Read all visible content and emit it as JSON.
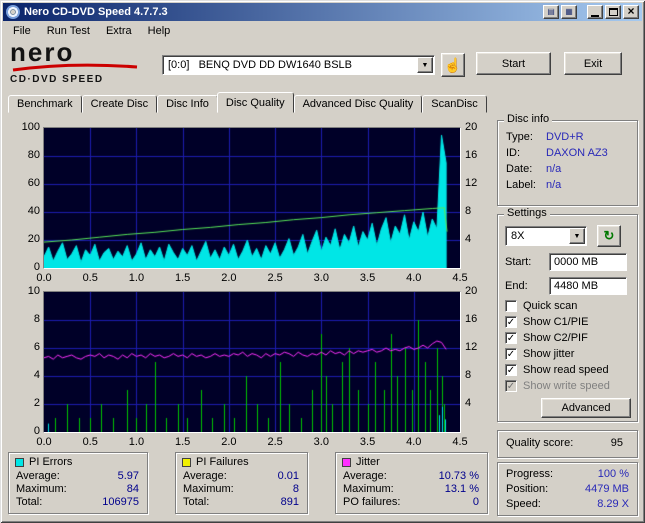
{
  "window": {
    "title": "Nero CD-DVD Speed 4.7.7.3",
    "menu_items": [
      "File",
      "Run Test",
      "Extra",
      "Help"
    ]
  },
  "icons": {
    "app": "cd-disc",
    "close": "×",
    "minimize": "minimize-bar",
    "maximize": "window-box",
    "dropdown": "▼",
    "check": "✓",
    "refresh": "↻",
    "hand": "☝",
    "extra1": "▤",
    "extra2": "▦"
  },
  "logo": {
    "brand": "nero",
    "product": "CD·DVD SPEED"
  },
  "toolbar": {
    "drive_selector": "[0:0]   BENQ DVD DD DW1640 BSLB",
    "start_button": "Start",
    "exit_button": "Exit"
  },
  "tabs": {
    "items": [
      {
        "label": "Benchmark",
        "active": false
      },
      {
        "label": "Create Disc",
        "active": false
      },
      {
        "label": "Disc Info",
        "active": false
      },
      {
        "label": "Disc Quality",
        "active": true
      },
      {
        "label": "Advanced Disc Quality",
        "active": false
      },
      {
        "label": "ScanDisc",
        "active": false
      }
    ]
  },
  "disc_info": {
    "title": "Disc info",
    "rows": [
      {
        "label": "Type:",
        "value": "DVD+R"
      },
      {
        "label": "ID:",
        "value": "DAXON AZ3"
      },
      {
        "label": "Date:",
        "value": "n/a"
      },
      {
        "label": "Label:",
        "value": "n/a"
      }
    ]
  },
  "settings": {
    "title": "Settings",
    "speed_value": "8X",
    "start_label": "Start:",
    "start_value": "0000 MB",
    "end_label": "End:",
    "end_value": "4480 MB",
    "checkboxes": [
      {
        "label": "Quick scan",
        "checked": false,
        "disabled": false
      },
      {
        "label": "Show C1/PIE",
        "checked": true,
        "disabled": false
      },
      {
        "label": "Show C2/PIF",
        "checked": true,
        "disabled": false
      },
      {
        "label": "Show jitter",
        "checked": true,
        "disabled": false
      },
      {
        "label": "Show read speed",
        "checked": true,
        "disabled": false
      },
      {
        "label": "Show write speed",
        "checked": true,
        "disabled": true
      }
    ],
    "advanced_button": "Advanced"
  },
  "quality": {
    "label": "Quality score:",
    "value": "95"
  },
  "progress": {
    "rows": [
      {
        "label": "Progress:",
        "value": "100 %"
      },
      {
        "label": "Position:",
        "value": "4479 MB"
      },
      {
        "label": "Speed:",
        "value": "8.29 X"
      }
    ]
  },
  "stats": {
    "pi_errors": {
      "title": "PI Errors",
      "color": "#00e6e6",
      "rows": [
        [
          "Average:",
          "5.97"
        ],
        [
          "Maximum:",
          "84"
        ],
        [
          "Total:",
          "106975"
        ]
      ]
    },
    "pi_failures": {
      "title": "PI Failures",
      "color": "#f0f000",
      "rows": [
        [
          "Average:",
          "0.01"
        ],
        [
          "Maximum:",
          "8"
        ],
        [
          "Total:",
          "891"
        ]
      ]
    },
    "jitter": {
      "title": "Jitter",
      "color": "#ff30ff",
      "rows": [
        [
          "Average:",
          "10.73 %"
        ],
        [
          "Maximum:",
          "13.1 %"
        ],
        [
          "PO failures:",
          "0"
        ]
      ]
    }
  },
  "colors": {
    "window_bg": "#d4d0c8",
    "titlebar_start": "#0a246a",
    "titlebar_end": "#a6caf0",
    "info_value": "#2929b8",
    "stat_value": "#00008c"
  },
  "chart_data": [
    {
      "type": "area",
      "x_axis": {
        "min": 0,
        "max": 4.5,
        "step": 0.5,
        "ticks": [
          "0.0",
          "0.5",
          "1.0",
          "1.5",
          "2.0",
          "2.5",
          "3.0",
          "3.5",
          "4.0",
          "4.5"
        ]
      },
      "left_axis": {
        "min": 0,
        "max": 100,
        "step": 20,
        "ticks": [
          100,
          80,
          60,
          40,
          20,
          0
        ]
      },
      "right_axis": {
        "min": 0,
        "max": 20,
        "ticks": [
          20,
          16,
          12,
          8,
          4
        ]
      },
      "bg_color": "#000028",
      "grid_color": "#1c1cb0",
      "series": [
        {
          "name": "pi-errors",
          "type": "area",
          "axis": "left",
          "color": "#00e6e6",
          "x0": 0,
          "dx": 0.05,
          "values": [
            8,
            15,
            5,
            12,
            18,
            6,
            10,
            16,
            4,
            13,
            9,
            17,
            5,
            11,
            14,
            6,
            12,
            8,
            16,
            5,
            10,
            18,
            6,
            13,
            8,
            15,
            5,
            17,
            11,
            6,
            14,
            9,
            16,
            5,
            12,
            19,
            7,
            13,
            6,
            15,
            9,
            17,
            6,
            12,
            20,
            8,
            14,
            6,
            16,
            10,
            18,
            7,
            13,
            21,
            9,
            15,
            24,
            10,
            19,
            27,
            12,
            22,
            16,
            28,
            13,
            24,
            18,
            30,
            15,
            26,
            20,
            32,
            16,
            28,
            36,
            18,
            30,
            24,
            38,
            20,
            33,
            26,
            40,
            22,
            35,
            28,
            95,
            75
          ]
        },
        {
          "name": "read-speed",
          "type": "line",
          "axis": "right",
          "color": "#58e858",
          "points": [
            [
              0,
              3.7
            ],
            [
              0.3,
              4.0
            ],
            [
              0.6,
              4.4
            ],
            [
              0.9,
              4.8
            ],
            [
              1.2,
              5.1
            ],
            [
              1.5,
              5.5
            ],
            [
              1.8,
              5.8
            ],
            [
              2.1,
              6.2
            ],
            [
              2.4,
              6.5
            ],
            [
              2.7,
              6.9
            ],
            [
              3.0,
              7.2
            ],
            [
              3.3,
              7.6
            ],
            [
              3.6,
              7.9
            ],
            [
              3.9,
              8.2
            ],
            [
              4.2,
              8.5
            ],
            [
              4.33,
              8.6
            ],
            [
              4.36,
              5.2
            ]
          ]
        }
      ]
    },
    {
      "type": "line",
      "x_axis": {
        "min": 0,
        "max": 4.5,
        "step": 0.5,
        "ticks": [
          "0.0",
          "0.5",
          "1.0",
          "1.5",
          "2.0",
          "2.5",
          "3.0",
          "3.5",
          "4.0",
          "4.5"
        ]
      },
      "left_axis": {
        "min": 0,
        "max": 10,
        "step": 2,
        "ticks": [
          10,
          8,
          6,
          4,
          2,
          0
        ]
      },
      "right_axis": {
        "min": 0,
        "max": 20,
        "ticks": [
          20,
          16,
          12,
          8,
          4
        ]
      },
      "bg_color": "#000028",
      "grid_color": "#1c1cb0",
      "series": [
        {
          "name": "pi-failures",
          "type": "spikes",
          "axis": "left",
          "color": "#00c400",
          "points": [
            [
              0.12,
              1
            ],
            [
              0.25,
              2
            ],
            [
              0.38,
              1
            ],
            [
              0.5,
              1
            ],
            [
              0.62,
              2
            ],
            [
              0.75,
              1
            ],
            [
              0.9,
              3
            ],
            [
              1.0,
              1
            ],
            [
              1.1,
              2
            ],
            [
              1.2,
              5
            ],
            [
              1.32,
              1
            ],
            [
              1.45,
              2
            ],
            [
              1.55,
              1
            ],
            [
              1.7,
              3
            ],
            [
              1.82,
              1
            ],
            [
              1.95,
              2
            ],
            [
              2.05,
              1
            ],
            [
              2.18,
              4
            ],
            [
              2.3,
              2
            ],
            [
              2.42,
              1
            ],
            [
              2.55,
              5
            ],
            [
              2.65,
              2
            ],
            [
              2.78,
              1
            ],
            [
              2.9,
              3
            ],
            [
              3.0,
              7
            ],
            [
              3.05,
              4
            ],
            [
              3.12,
              2
            ],
            [
              3.22,
              5
            ],
            [
              3.3,
              6
            ],
            [
              3.4,
              3
            ],
            [
              3.5,
              2
            ],
            [
              3.58,
              5
            ],
            [
              3.68,
              3
            ],
            [
              3.75,
              7
            ],
            [
              3.82,
              4
            ],
            [
              3.9,
              6
            ],
            [
              3.98,
              3
            ],
            [
              4.05,
              8
            ],
            [
              4.12,
              5
            ],
            [
              4.18,
              3
            ],
            [
              4.25,
              6
            ],
            [
              4.3,
              4
            ],
            [
              4.33,
              2
            ]
          ]
        },
        {
          "name": "po-failures",
          "type": "spikes",
          "axis": "left",
          "color": "#00e6e6",
          "points": [
            [
              0.04,
              0.6
            ],
            [
              4.27,
              1.2
            ],
            [
              4.31,
              1.8
            ],
            [
              4.34,
              0.9
            ]
          ]
        },
        {
          "name": "jitter",
          "type": "line",
          "axis": "left",
          "color": "#ff30ff",
          "x0": 0,
          "dx": 0.05,
          "values": [
            5.3,
            5.4,
            5.2,
            5.5,
            5.3,
            5.4,
            5.5,
            5.3,
            5.2,
            5.4,
            5.5,
            5.4,
            5.6,
            5.3,
            5.5,
            5.4,
            5.2,
            5.5,
            5.3,
            5.6,
            5.4,
            5.5,
            5.3,
            5.6,
            5.4,
            5.5,
            5.3,
            5.4,
            5.6,
            5.4,
            5.5,
            5.3,
            5.6,
            5.4,
            5.5,
            5.3,
            5.4,
            5.6,
            5.4,
            5.5,
            5.4,
            5.6,
            5.5,
            5.7,
            5.4,
            5.6,
            5.5,
            5.3,
            5.6,
            5.4,
            5.6,
            5.5,
            5.7,
            5.6,
            5.4,
            5.7,
            5.5,
            5.4,
            5.6,
            5.5,
            5.7,
            5.5,
            5.8,
            5.6,
            5.7,
            5.5,
            5.8,
            5.6,
            5.8,
            5.7,
            5.8,
            5.9,
            5.7,
            5.8,
            6.0,
            5.8,
            5.9,
            5.8,
            6.0,
            6.1,
            5.9,
            6.0,
            6.2,
            6.0,
            6.3,
            6.5,
            6.4,
            5.9
          ]
        }
      ]
    }
  ]
}
